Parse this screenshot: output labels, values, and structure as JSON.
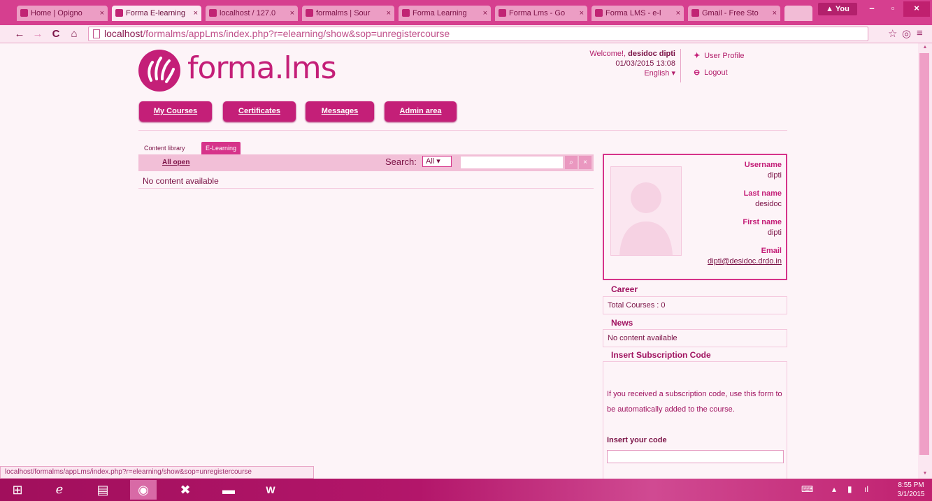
{
  "browser": {
    "tabs": [
      {
        "label": "Home | Opigno",
        "active": false
      },
      {
        "label": "Forma E-learning",
        "active": true
      },
      {
        "label": "localhost / 127.0",
        "active": false
      },
      {
        "label": "formalms | Sour",
        "active": false
      },
      {
        "label": "Forma Learning",
        "active": false
      },
      {
        "label": "Forma Lms - Go",
        "active": false
      },
      {
        "label": "Forma LMS - e-l",
        "active": false
      },
      {
        "label": "Gmail - Free Sto",
        "active": false
      }
    ],
    "user_chip": "You",
    "url_host": "localhost",
    "url_path": "/formalms/appLms/index.php?r=elearning/show&sop=unregistercourse"
  },
  "header": {
    "logo_text": "forma.lms",
    "welcome_prefix": "Welcome!,",
    "user_name": "desidoc dipti",
    "date": "01/03/2015 13:08",
    "language": "English",
    "user_profile_link": "User Profile",
    "logout_link": "Logout"
  },
  "nav": {
    "my_courses": "My Courses",
    "certificates": "Certificates",
    "messages": "Messages",
    "admin_area": "Admin area"
  },
  "content": {
    "tab_content_library": "Content library",
    "tab_elearning": "E-Learning",
    "all_open": "All open",
    "search_label": "Search:",
    "search_filter": "All",
    "no_content": "No content available"
  },
  "profile": {
    "username_label": "Username",
    "username": "dipti",
    "lastname_label": "Last name",
    "lastname": "desidoc",
    "firstname_label": "First name",
    "firstname": "dipti",
    "email_label": "Email",
    "email": "dipti@desidoc.drdo.in"
  },
  "sidebar": {
    "career_title": "Career",
    "total_courses": "Total Courses : 0",
    "news_title": "News",
    "news_empty": "No content available",
    "subscription_title": "Insert Subscription Code",
    "subscription_text": "If you received a subscription code, use this form to be automatically added to the course.",
    "code_label": "Insert your code"
  },
  "status_bar": "localhost/formalms/appLms/index.php?r=elearning/show&sop=unregistercourse",
  "taskbar": {
    "time": "8:55 PM",
    "date": "3/1/2015"
  },
  "colors": {
    "accent": "#c41f78",
    "tint": "#fdf4f8"
  }
}
